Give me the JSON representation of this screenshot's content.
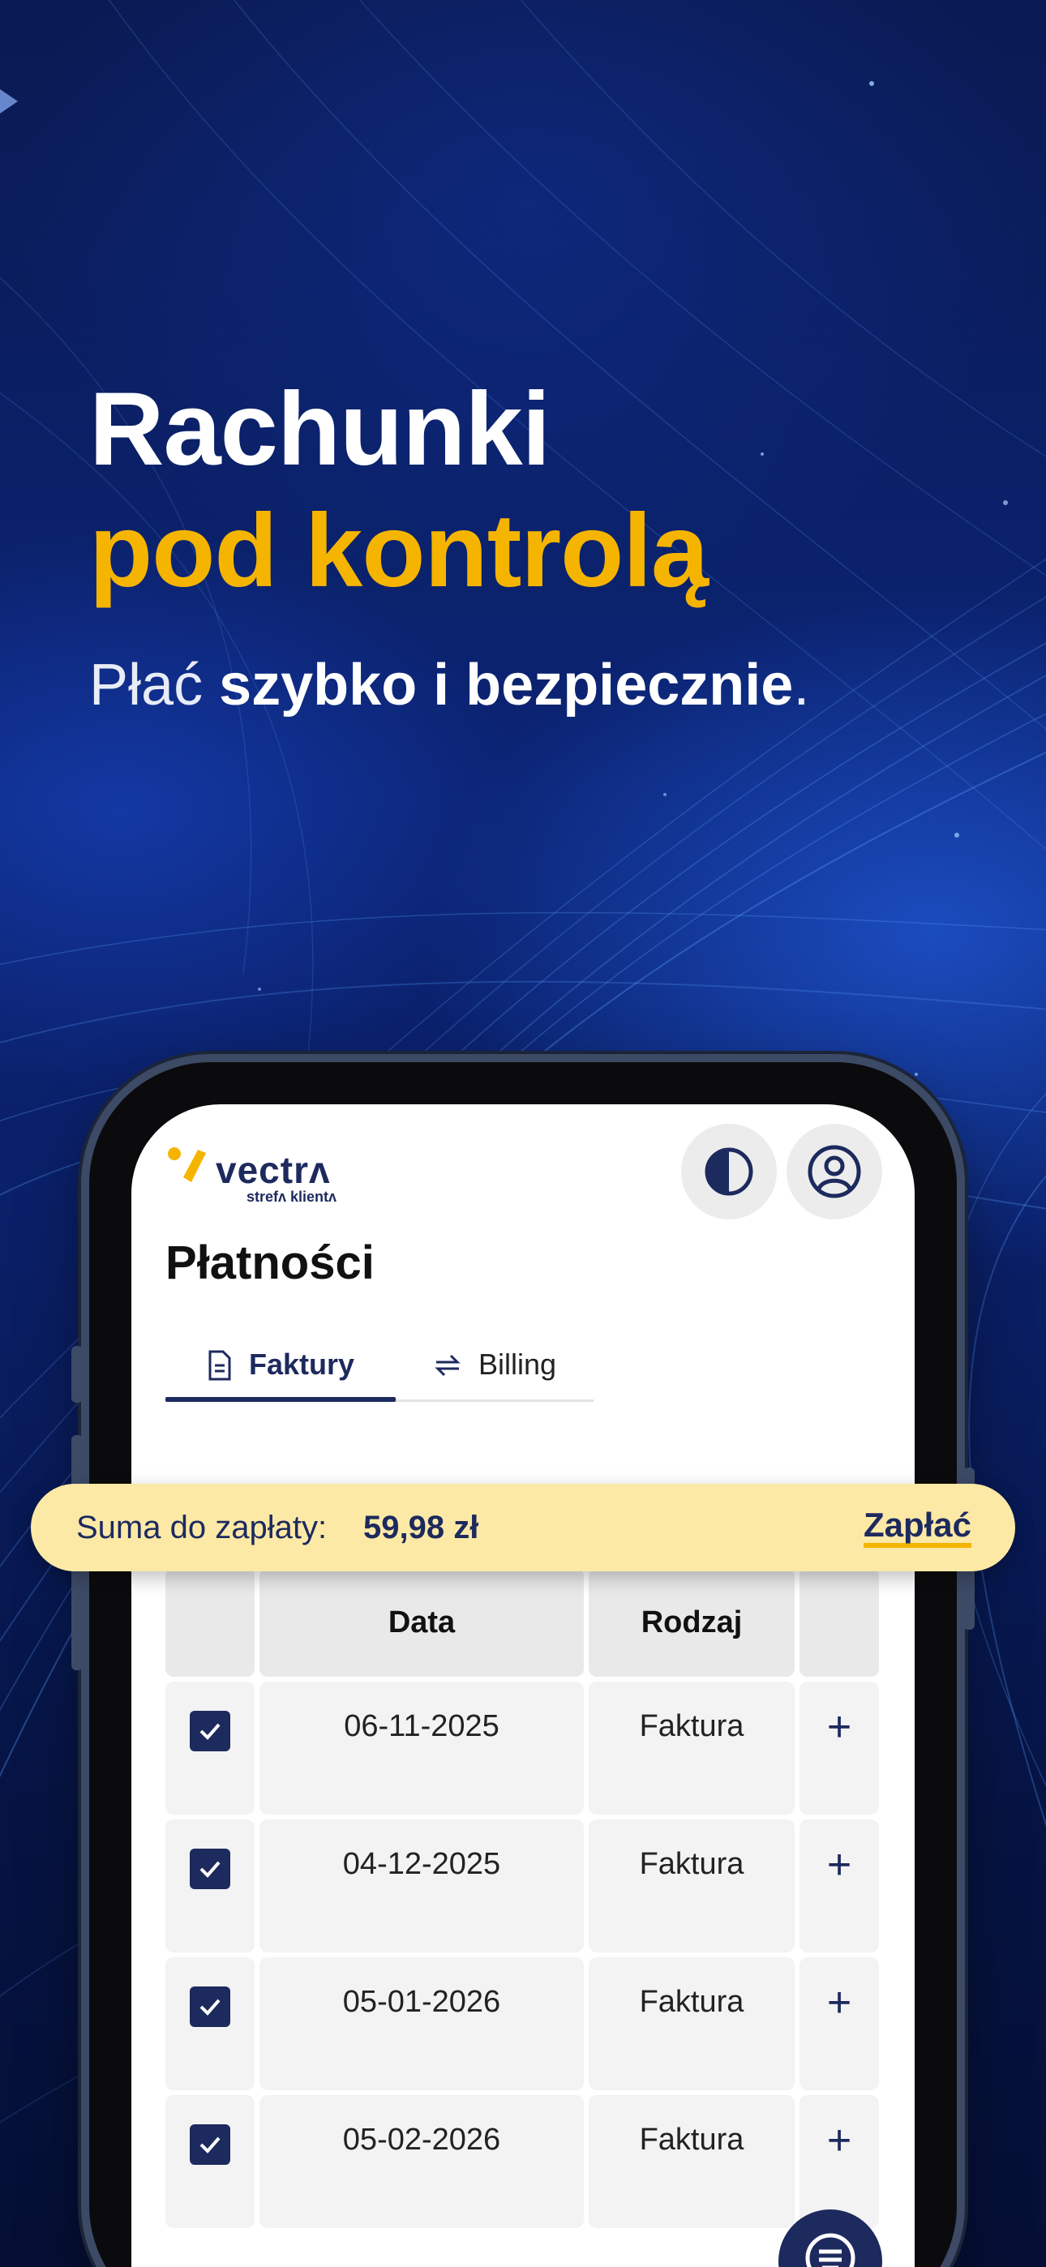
{
  "hero": {
    "line1": "Rachunki",
    "line2": "pod kontrolą",
    "sub_light": "Płać",
    "sub_bold": "szybko i bezpiecznie",
    "sub_dot": "."
  },
  "colors": {
    "brand_navy": "#1d2a5e",
    "accent_yellow": "#f5b400",
    "banner_bg": "#fde9a6",
    "background": "#0b2475"
  },
  "app": {
    "logo_word": "vectrʌ",
    "logo_sub": "strefʌ klientʌ",
    "theme_icon": "contrast-icon",
    "account_icon": "user-circle-icon",
    "title": "Płatności",
    "tabs": [
      {
        "label": "Faktury",
        "icon": "document-icon",
        "active": true
      },
      {
        "label": "Billing",
        "icon": "swap-arrows-icon",
        "active": false
      }
    ],
    "payment": {
      "label": "Suma do zapłaty:",
      "amount": "59,98 zł",
      "action": "Zapłać"
    },
    "table": {
      "headers": [
        "",
        "Data",
        "Rodzaj",
        ""
      ],
      "rows": [
        {
          "checked": true,
          "date": "06-11-2025",
          "type": "Faktura"
        },
        {
          "checked": true,
          "date": "04-12-2025",
          "type": "Faktura"
        },
        {
          "checked": true,
          "date": "05-01-2026",
          "type": "Faktura"
        },
        {
          "checked": true,
          "date": "05-02-2026",
          "type": "Faktura"
        }
      ]
    },
    "fab_icon": "menu-lines-icon"
  }
}
